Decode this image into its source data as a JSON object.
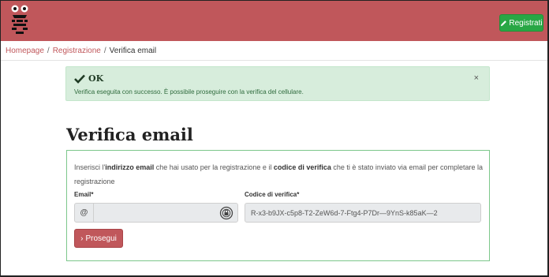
{
  "header": {
    "logo_icon": "owl-logo-icon",
    "register_label": "Registrati",
    "register_icon": "pencil-icon",
    "brand_color": "#c0575b",
    "accent_green": "#28a745"
  },
  "breadcrumb": {
    "home": "Homepage",
    "registration": "Registrazione",
    "current": "Verifica email",
    "separator": "/"
  },
  "alert": {
    "title": "OK",
    "title_icon": "checkmark-icon",
    "message": "Verifica eseguita con successo. È possibile proseguire con la verifica del cellulare.",
    "close": "×"
  },
  "page": {
    "title": "Verifica email"
  },
  "form": {
    "description": {
      "part1": "Inserisci l'",
      "bold1": "indirizzo email",
      "part2": " che hai usato per la registrazione e il ",
      "bold2": "codice di verifica",
      "part3": " che ti è stato inviato via email per completare la registrazione"
    },
    "email_label": "Email*",
    "email_prefix": "@",
    "email_value": "",
    "email_icon": "password-manager-icon",
    "code_label": "Codice di verifica*",
    "code_value": "R-x3-b9JX-c5p8-T2-ZeW6d-7-Ftg4-P7Dr—9YnS-k85aK—2",
    "submit_label": "Prosegui",
    "submit_icon": "chevron-right-icon"
  }
}
